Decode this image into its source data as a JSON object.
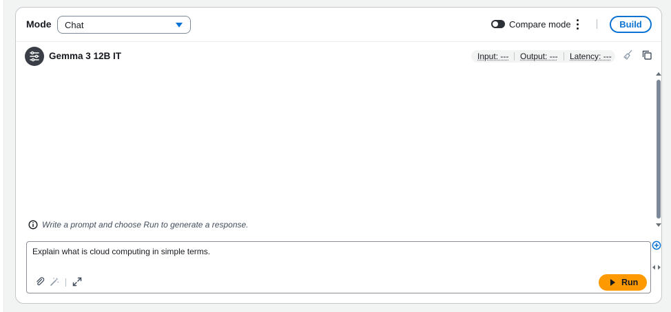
{
  "header": {
    "mode_label": "Mode",
    "mode_value": "Chat",
    "compare_label": "Compare mode",
    "build_label": "Build"
  },
  "model": {
    "name": "Gemma 3 12B IT",
    "metrics": {
      "input": "Input: ---",
      "output": "Output: ---",
      "latency": "Latency: ---"
    }
  },
  "chat": {
    "hint": "Write a prompt and choose Run to generate a response."
  },
  "prompt": {
    "text": "Explain what is cloud computing in simple terms.",
    "run_label": "Run"
  },
  "colors": {
    "accent": "#0972d3",
    "run": "#ff9900",
    "avatar": "#3a3f47"
  }
}
